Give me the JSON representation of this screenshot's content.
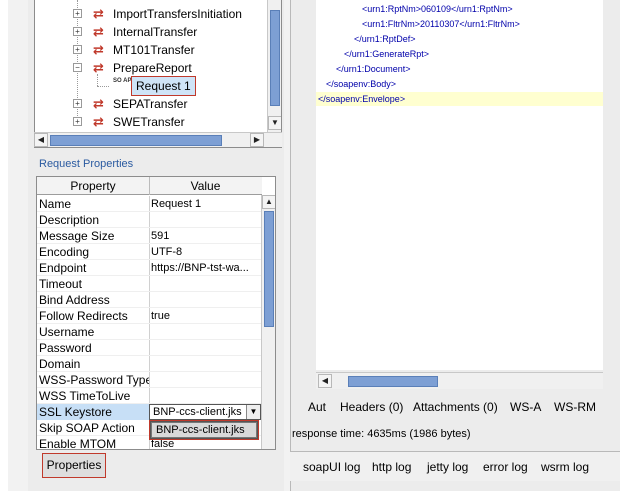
{
  "tree": {
    "items": [
      {
        "label": "ImportTransfersInitiation"
      },
      {
        "label": "InternalTransfer"
      },
      {
        "label": "MT101Transfer"
      },
      {
        "label": "PrepareReport"
      },
      {
        "label": "Request 1",
        "icon": "SO AP"
      },
      {
        "label": "SEPATransfer"
      },
      {
        "label": "SWETransfer"
      }
    ]
  },
  "request_properties": {
    "title": "Request Properties",
    "columns": [
      "Property",
      "Value"
    ],
    "rows": [
      {
        "property": "Name",
        "value": "Request 1"
      },
      {
        "property": "Description",
        "value": ""
      },
      {
        "property": "Message Size",
        "value": "591"
      },
      {
        "property": "Encoding",
        "value": "UTF-8"
      },
      {
        "property": "Endpoint",
        "value": "https://BNP-tst-wa..."
      },
      {
        "property": "Timeout",
        "value": ""
      },
      {
        "property": "Bind Address",
        "value": ""
      },
      {
        "property": "Follow Redirects",
        "value": "true"
      },
      {
        "property": "Username",
        "value": ""
      },
      {
        "property": "Password",
        "value": ""
      },
      {
        "property": "Domain",
        "value": ""
      },
      {
        "property": "WSS-Password Type",
        "value": ""
      },
      {
        "property": "WSS TimeToLive",
        "value": ""
      },
      {
        "property": "SSL Keystore",
        "value": "BNP-ccs-client.jks"
      },
      {
        "property": "Skip SOAP Action",
        "value": ""
      },
      {
        "property": "Enable MTOM",
        "value": "false"
      }
    ],
    "dropdown_option": "BNP-ccs-client.jks"
  },
  "properties_button": "Properties",
  "xml": {
    "lines": [
      "<urn1:RptNm>060109</urn1:RptNm>",
      "<urn1:FltrNm>20110307</urn1:FltrNm>",
      "</urn1:RptDef>",
      "</urn1:GenerateRpt>",
      "</urn1:Document>",
      "</soapenv:Body>",
      "</soapenv:Envelope>"
    ]
  },
  "tabs": [
    "Aut",
    "Headers (0)",
    "Attachments (0)",
    "WS-A",
    "WS-RM"
  ],
  "response_time": "response time: 4635ms (1986 bytes)",
  "log_tabs": [
    "soapUI log",
    "http log",
    "jetty log",
    "error log",
    "wsrm log"
  ]
}
